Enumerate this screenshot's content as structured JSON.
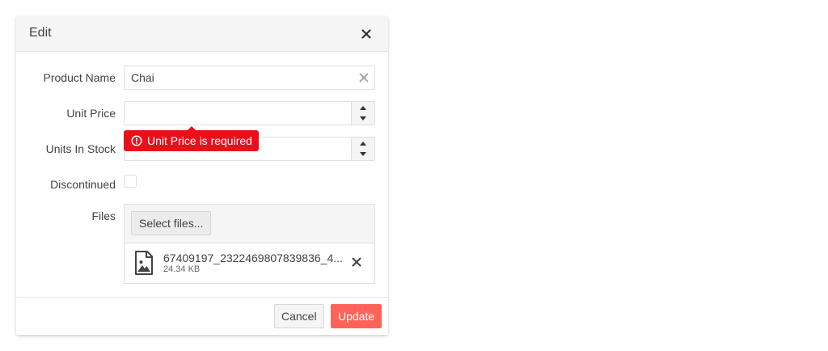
{
  "dialog": {
    "title": "Edit",
    "close_icon": "close-icon"
  },
  "form": {
    "product_name": {
      "label": "Product Name",
      "value": "Chai",
      "clear_icon": "clear-icon"
    },
    "unit_price": {
      "label": "Unit Price",
      "value": ""
    },
    "units_in_stock": {
      "label": "Units In Stock",
      "value": ""
    },
    "discontinued": {
      "label": "Discontinued",
      "checked": false
    },
    "files": {
      "label": "Files"
    }
  },
  "validation": {
    "message": "Unit Price is required",
    "color": "#e8111a",
    "icon": "warning-icon"
  },
  "upload": {
    "select_label": "Select files...",
    "file": {
      "name": "67409197_2322469807839836_4...",
      "size": "24.34 KB",
      "icon": "image-file-icon",
      "remove_icon": "close-icon"
    }
  },
  "footer": {
    "cancel_label": "Cancel",
    "update_label": "Update",
    "primary_color": "#ff6358"
  }
}
